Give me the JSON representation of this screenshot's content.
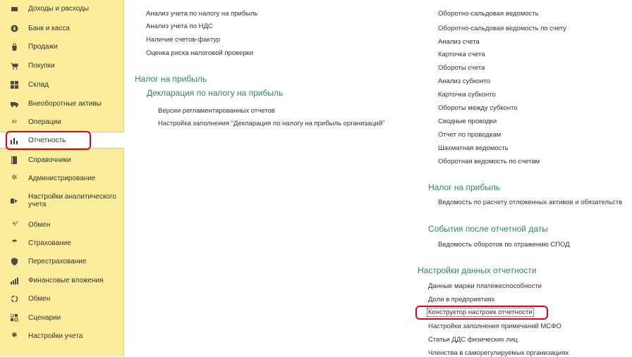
{
  "sidebar": {
    "items": [
      {
        "label": "Доходы и расходы",
        "icon": "income-expense-icon"
      },
      {
        "label": "Банк и касса",
        "icon": "bank-icon"
      },
      {
        "label": "Продажи",
        "icon": "sales-icon"
      },
      {
        "label": "Покупки",
        "icon": "cart-icon"
      },
      {
        "label": "Склад",
        "icon": "warehouse-icon"
      },
      {
        "label": "Внеоборотные активы",
        "icon": "truck-icon"
      },
      {
        "label": "Операции",
        "icon": "operations-icon"
      },
      {
        "label": "Отчетность",
        "icon": "bar-chart-icon"
      },
      {
        "label": "Справочники",
        "icon": "book-icon"
      },
      {
        "label": "Администрирование",
        "icon": "gear-icon"
      },
      {
        "label": "Настройки аналитического учета",
        "icon": "analytics-settings-icon"
      },
      {
        "label": "Обмен",
        "icon": "exchange-icon"
      },
      {
        "label": "Страхование",
        "icon": "umbrella-icon"
      },
      {
        "label": "Перестрахование",
        "icon": "shield-icon"
      },
      {
        "label": "Финансовые вложения",
        "icon": "investments-icon"
      },
      {
        "label": "Обмен",
        "icon": "sync-ring-icon"
      },
      {
        "label": "Сценарии",
        "icon": "scenarios-icon"
      },
      {
        "label": "Настройки учета",
        "icon": "settings-gear-icon"
      }
    ]
  },
  "left_column": {
    "links_top": [
      "Анализ учета по налогу на прибыль",
      "Анализ учета по НДС",
      "Наличие счетов-фактур",
      "Оценка риска налоговой проверки"
    ],
    "section_title": "Налог на прибыль",
    "subsection_title": "Декларация по налогу на прибыль",
    "subsection_links": [
      "Версии регламентированных отчетов",
      "Настройка заполнения \"Декларация по налогу на прибыль организаций\""
    ]
  },
  "right_column": {
    "links_top": [
      "Оборотно-сальдовая ведомость",
      "Оборотно-сальдовая ведомость по счету",
      "Анализ счета",
      "Карточка счета",
      "Обороты счета",
      "Анализ субконто",
      "Карточка субконто",
      "Обороты между субконто",
      "Сводные проводки",
      "Отчет по проводкам",
      "Шахматная ведомость",
      "Оборотная ведомость по счетам"
    ],
    "section_tax": {
      "title": "Налог на прибыль",
      "links": [
        "Ведомость по расчету отложенных активов и обязательств"
      ]
    },
    "section_events": {
      "title": "События после отчетной даты",
      "links": [
        "Ведомость оборотов по отражению СПОД"
      ]
    },
    "section_settings": {
      "title": "Настройки данных отчетности",
      "links": [
        "Данные маржи платежеспособности",
        "Доли в предприятиях",
        "Конструктор настроек отчетности",
        "Настройки заполнения примечаний МСФО",
        "Статьи ДДС физических лиц",
        "Членства в саморегулируемых организациях"
      ]
    }
  },
  "colors": {
    "sidebar_bg": "#fbec9b",
    "section_green": "#2e8b57",
    "highlight_red": "#e0001b"
  }
}
